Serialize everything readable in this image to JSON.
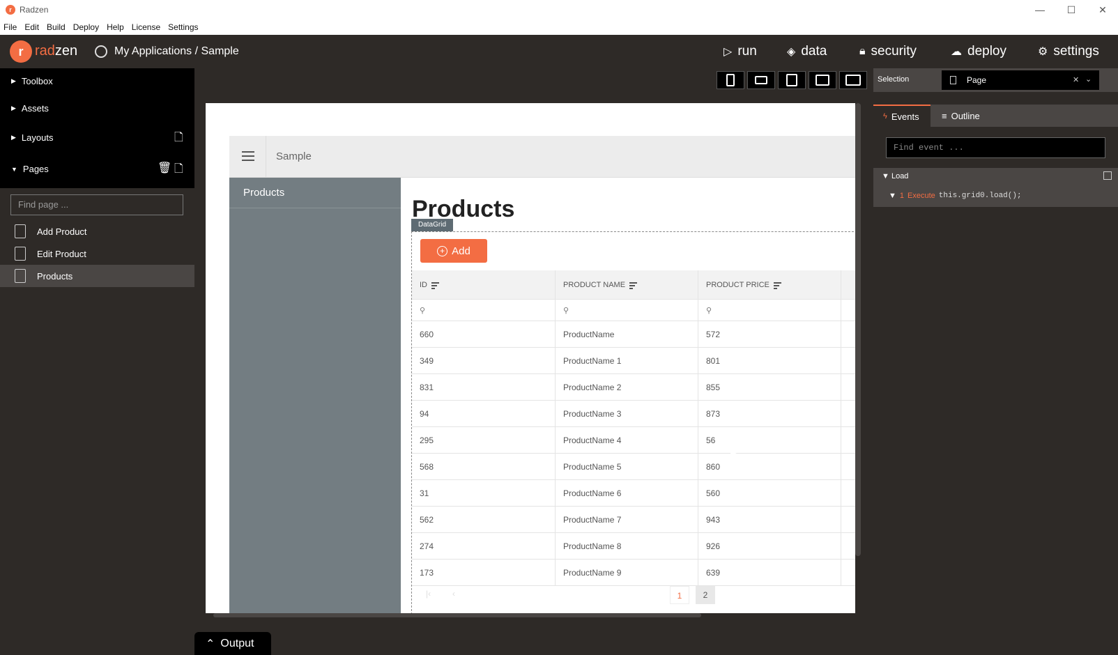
{
  "window": {
    "title": "Radzen",
    "minimize": "—",
    "maximize": "☐",
    "close": "✕"
  },
  "menubar": [
    "File",
    "Edit",
    "Build",
    "Deploy",
    "Help",
    "License",
    "Settings"
  ],
  "topnav": {
    "logo_mark": "r",
    "logo_part1": "rad",
    "logo_part2": "zen",
    "breadcrumb": "My Applications / Sample",
    "items": [
      {
        "label": "run",
        "icon": "play-icon"
      },
      {
        "label": "data",
        "icon": "layers-icon"
      },
      {
        "label": "security",
        "icon": "lock-icon"
      },
      {
        "label": "deploy",
        "icon": "cloud-upload-icon"
      },
      {
        "label": "settings",
        "icon": "gear-icon"
      }
    ]
  },
  "sidebar": {
    "sections": [
      "Toolbox",
      "Assets",
      "Layouts",
      "Pages"
    ],
    "find_page_placeholder": "Find page ...",
    "pages": [
      "Add Product",
      "Edit Product",
      "Products"
    ],
    "active_page": "Products"
  },
  "canvas": {
    "app_name": "Sample",
    "side_item": "Products",
    "heading": "Products",
    "component_tag": "DataGrid",
    "add_button": "Add",
    "columns": [
      "ID",
      "PRODUCT NAME",
      "PRODUCT PRICE"
    ],
    "rows": [
      [
        "660",
        "ProductName",
        "572"
      ],
      [
        "349",
        "ProductName 1",
        "801"
      ],
      [
        "831",
        "ProductName 2",
        "855"
      ],
      [
        "94",
        "ProductName 3",
        "873"
      ],
      [
        "295",
        "ProductName 4",
        "56"
      ],
      [
        "568",
        "ProductName 5",
        "860"
      ],
      [
        "31",
        "ProductName 6",
        "560"
      ],
      [
        "562",
        "ProductName 7",
        "943"
      ],
      [
        "274",
        "ProductName 8",
        "926"
      ],
      [
        "173",
        "ProductName 9",
        "639"
      ]
    ],
    "pages": [
      "1",
      "2"
    ],
    "current_page": "1",
    "accent_color": "#f36d43"
  },
  "right_panel": {
    "selection_label": "Selection",
    "selection_value": "Page",
    "tabs": [
      "Events",
      "Outline"
    ],
    "find_event_placeholder": "Find event ...",
    "event_name": "Load",
    "action_index": "1",
    "action_type": "Execute",
    "action_code": "this.grid0.load();"
  },
  "output_label": "Output"
}
